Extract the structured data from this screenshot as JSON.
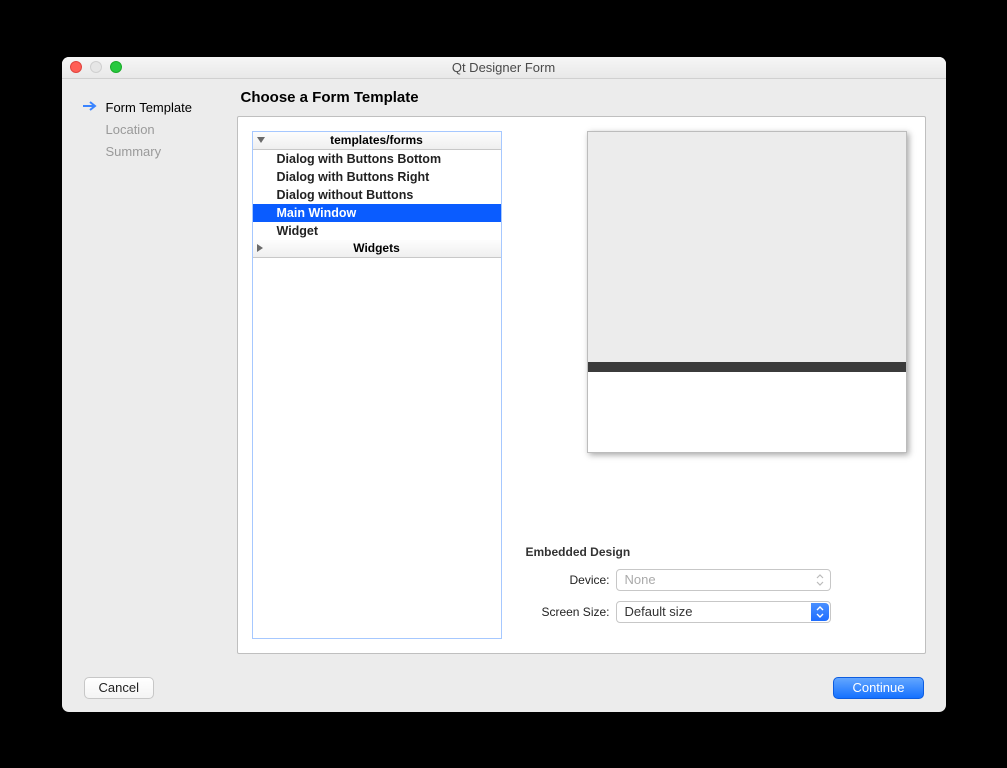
{
  "window": {
    "title": "Qt Designer Form"
  },
  "sidebar": {
    "items": [
      {
        "label": "Form Template",
        "active": true
      },
      {
        "label": "Location",
        "active": false
      },
      {
        "label": "Summary",
        "active": false
      }
    ]
  },
  "main": {
    "title": "Choose a Form Template",
    "tree": {
      "groups": [
        {
          "label": "templates/forms",
          "expanded": true,
          "items": [
            "Dialog with Buttons Bottom",
            "Dialog with Buttons Right",
            "Dialog without Buttons",
            "Main Window",
            "Widget"
          ],
          "selected_index": 3
        },
        {
          "label": "Widgets",
          "expanded": false,
          "items": []
        }
      ]
    },
    "embedded": {
      "title": "Embedded Design",
      "device_label": "Device:",
      "device_value": "None",
      "size_label": "Screen Size:",
      "size_value": "Default size"
    }
  },
  "footer": {
    "cancel": "Cancel",
    "continue": "Continue"
  }
}
